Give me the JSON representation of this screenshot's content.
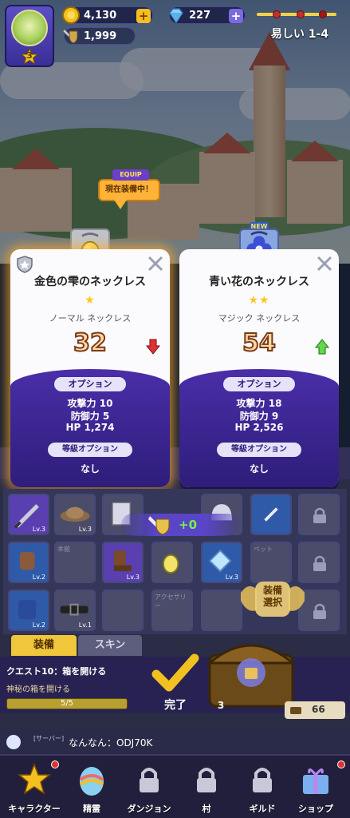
{
  "hud": {
    "level": "3",
    "gold": "4,130",
    "gems": "227",
    "power": "1,999",
    "stage": "易しい 1-4"
  },
  "equip_badge": {
    "tag": "EQUIP",
    "text": "現在装備中！"
  },
  "current_item": {
    "name": "金色の雫のネックレス",
    "stars": "★",
    "type": "ノーマル ネックレス",
    "power": "32",
    "power_trend": "down",
    "options_label": "オプション",
    "stats": [
      "攻撃力 10",
      "防御力 5",
      "HP 1,274"
    ],
    "grade_label": "等級オプション",
    "grade_value": "なし"
  },
  "new_item": {
    "badge": "NEW",
    "name": "青い花のネックレス",
    "stars": "★★",
    "type": "マジック ネックレス",
    "power": "54",
    "power_trend": "up",
    "options_label": "オプション",
    "stats": [
      "攻撃力 18",
      "防御力 9",
      "HP 2,526"
    ],
    "grade_label": "等級オプション",
    "grade_value": "なし"
  },
  "combo": {
    "value": "+0"
  },
  "inventory": {
    "slot_levels": [
      "Lv.3",
      "Lv.3",
      "Lv.2",
      "Lv.3",
      "Lv.3",
      "Lv.2",
      "Lv.1"
    ],
    "ghost_labels": [
      "本拠",
      "ペット",
      "アクセサリー"
    ],
    "equip_select": "装備\n選択"
  },
  "tabs": {
    "equip": "装備",
    "skin": "スキン"
  },
  "quest": {
    "title": "クエスト10：箱を開ける",
    "sub": "神秘の箱を開ける",
    "progress_text": "5/5",
    "progress": 1.0
  },
  "done_label": "完了",
  "chest": {
    "count": "66",
    "num": "3"
  },
  "chat": {
    "server": "[サーバー]",
    "message": "なんなん：ODJ70K"
  },
  "nav": [
    {
      "label": "キャラクター",
      "badge": true
    },
    {
      "label": "精霊",
      "badge": false
    },
    {
      "label": "ダンジョン",
      "badge": false
    },
    {
      "label": "村",
      "badge": false
    },
    {
      "label": "ギルド",
      "badge": false
    },
    {
      "label": "ショップ",
      "badge": true
    }
  ],
  "colors": {
    "accent_purple": "#4a2ea8",
    "gold": "#f0c63a",
    "down_red": "#e03232",
    "up_green": "#5fd84a"
  }
}
